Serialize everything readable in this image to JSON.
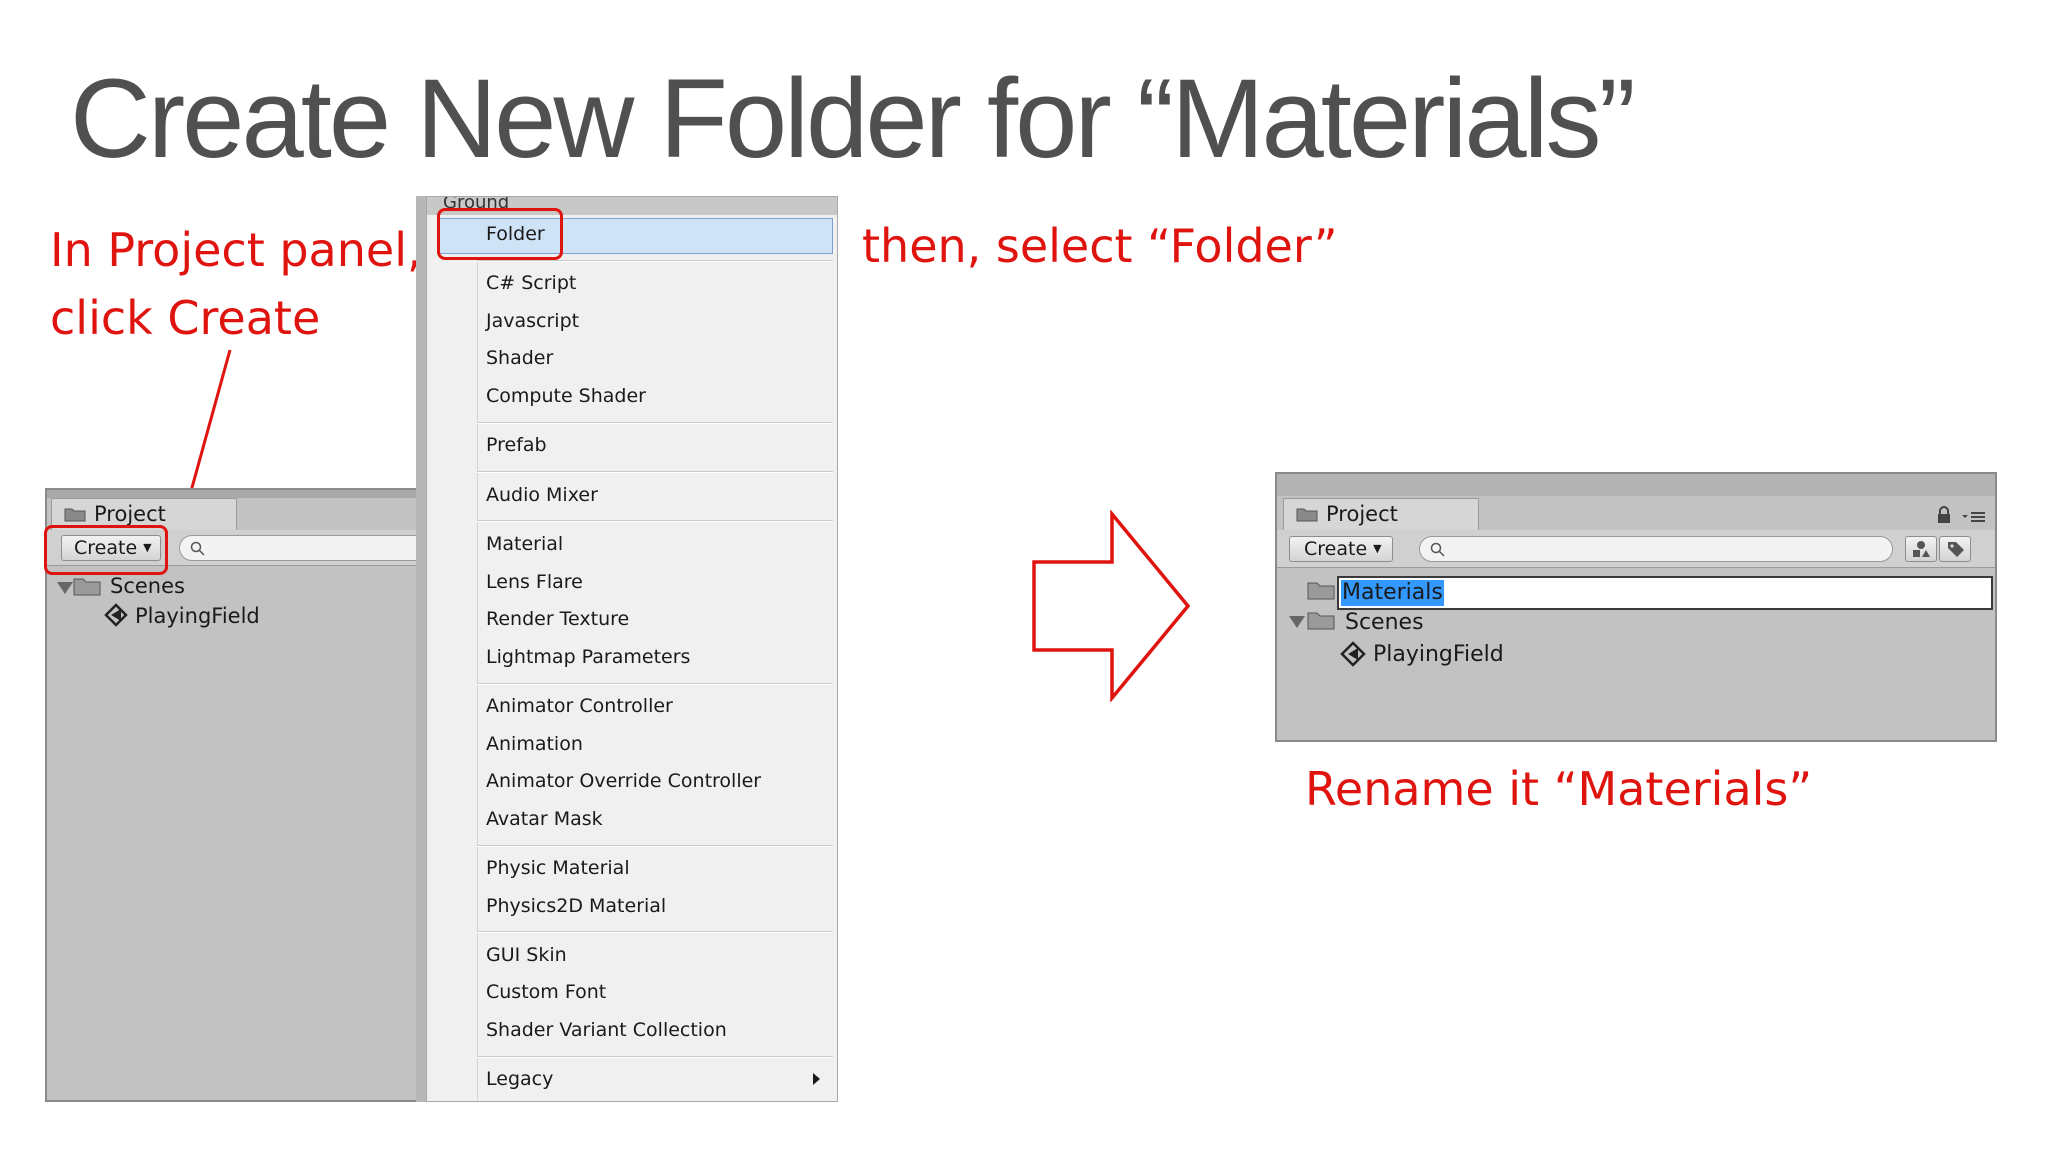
{
  "slide": {
    "title": "Create New Folder for “Materials”"
  },
  "annotations": {
    "step1_line1": "In Project panel,",
    "step1_line2": "click Create",
    "step2": "then, select “Folder”",
    "step3": "Rename it “Materials”"
  },
  "left_panel": {
    "tab_label": "Project",
    "create_label": "Create",
    "tree": [
      {
        "label": "Scenes",
        "icon": "folder-icon"
      },
      {
        "label": "PlayingField",
        "icon": "unity-scene-icon"
      }
    ]
  },
  "context_menu": {
    "header": "Ground",
    "groups": [
      [
        "Folder"
      ],
      [
        "C# Script",
        "Javascript",
        "Shader",
        "Compute Shader"
      ],
      [
        "Prefab"
      ],
      [
        "Audio Mixer"
      ],
      [
        "Material",
        "Lens Flare",
        "Render Texture",
        "Lightmap Parameters"
      ],
      [
        "Animator Controller",
        "Animation",
        "Animator Override Controller",
        "Avatar Mask"
      ],
      [
        "Physic Material",
        "Physics2D Material"
      ],
      [
        "GUI Skin",
        "Custom Font",
        "Shader Variant Collection"
      ],
      [
        "Legacy"
      ]
    ],
    "highlighted": "Folder",
    "submenu_item": "Legacy"
  },
  "right_panel": {
    "tab_label": "Project",
    "create_label": "Create",
    "rename_value": "Materials",
    "tree": [
      {
        "label": "Scenes",
        "icon": "folder-icon"
      },
      {
        "label": "PlayingField",
        "icon": "unity-scene-icon"
      }
    ]
  },
  "colors": {
    "annotation_red": "#e0140f",
    "title_gray": "#505050",
    "panel_gray": "#c2c2c2",
    "selection_blue": "#3399ff"
  }
}
